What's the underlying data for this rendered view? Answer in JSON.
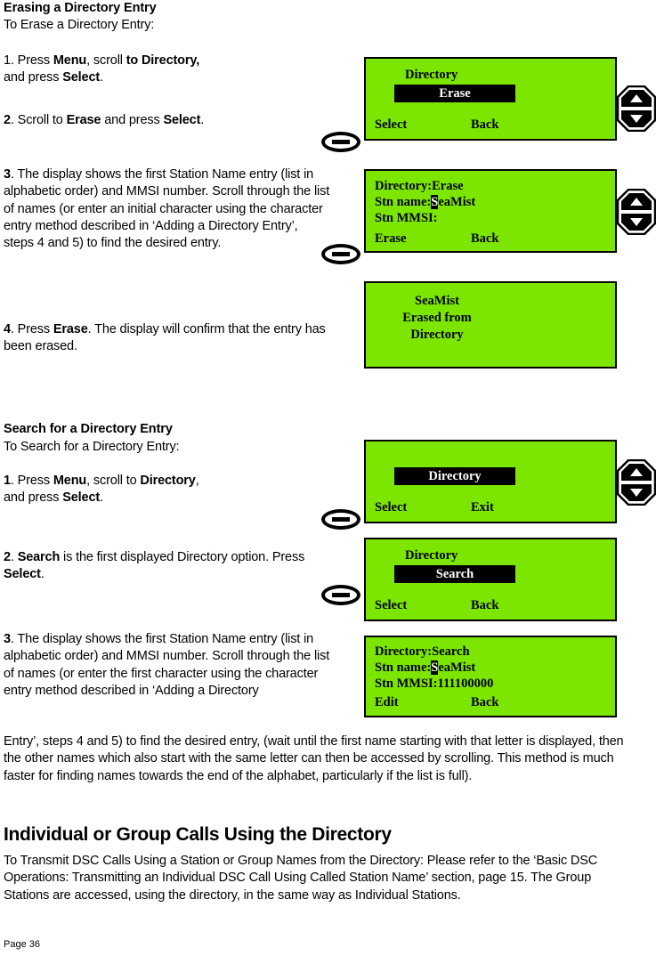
{
  "document": {
    "page_label": "Page 36"
  },
  "sections": {
    "erase": {
      "heading": "Erasing a Directory Entry",
      "subheading": "To Erase a Directory Entry:",
      "step1_line1_a": "1. Press ",
      "step1_line1_b": "Menu",
      "step1_line1_c": ", scroll ",
      "step1_line1_d": "to Directory,",
      "step1_line2_a": "and press ",
      "step1_line2_b": "Select",
      "step1_line2_c": ".",
      "step2_a": "2",
      "step2_b": ". Scroll to ",
      "step2_c": "Erase",
      "step2_d": " and press ",
      "step2_e": "Select",
      "step2_f": ".",
      "step3_a": "3",
      "step3_b": ". The display shows the first Station Name entry (list in alphabetic order) and MMSI number. Scroll through the list of names (or enter an initial character using the character entry method described in ‘Adding a Directory Entry’, steps 4 and 5) to find the desired entry.",
      "step4_a": "4",
      "step4_b": ". Press ",
      "step4_c": "Erase",
      "step4_d": ". The display will confirm that the entry has been erased."
    },
    "search": {
      "heading": "Search for a Directory Entry",
      "subheading": "To Search for a Directory Entry:",
      "step1_a": "1",
      "step1_b": ". Press ",
      "step1_c": "Menu",
      "step1_d": ", scroll to ",
      "step1_e": "Directory",
      "step1_f": ",",
      "step1_line2_a": "and press ",
      "step1_line2_b": "Select",
      "step1_line2_c": ".",
      "step2_a": "2",
      "step2_b": ". ",
      "step2_c": "Search",
      "step2_d": " is the first displayed Directory option. Press ",
      "step2_e": "Select",
      "step2_f": ".",
      "step3_col_a": "3",
      "step3_col_b": ". The display shows the first Station Name entry (list in alphabetic order) and MMSI number. Scroll through the list of names (or enter the first character using the character entry method described in ‘Adding a Directory",
      "step3_full": "Entry’, steps 4 and 5) to find the desired entry, (wait until the first name starting with that letter is displayed, then the other names which also start with the same letter can then be accessed by scrolling. This method is much faster for finding names towards the end of the alphabet, particularly if the list is full)."
    },
    "calls": {
      "heading": "Individual or Group Calls Using the Directory",
      "body": "To Transmit DSC Calls Using a Station or Group Names from the Directory: Please refer to the ‘Basic DSC Operations: Transmitting an Individual DSC Call Using Called Station Name’ section, page 15. The Group Stations are accessed, using the directory, in the same way as Individual Stations."
    }
  },
  "lcd_screens": [
    {
      "id": "erase-menu",
      "title": "Directory",
      "selected": "Erase",
      "softkey_left": "Select",
      "softkey_right": "Back"
    },
    {
      "id": "erase-entry",
      "line1": "Directory:Erase",
      "line2_label": "Stn name:",
      "line2_cursor": "S",
      "line2_rest": "eaMist",
      "line3": "Stn MMSI:",
      "softkey_left": "Erase",
      "softkey_right": "Back"
    },
    {
      "id": "erase-confirm",
      "line1": "SeaMist",
      "line2": "Erased from",
      "line3": "Directory"
    },
    {
      "id": "search-menu-directory",
      "selected": "Directory",
      "softkey_left": "Select",
      "softkey_right": "Exit"
    },
    {
      "id": "search-menu-search",
      "title": "Directory",
      "selected": "Search",
      "softkey_left": "Select",
      "softkey_right": "Back"
    },
    {
      "id": "search-entry",
      "line1": "Directory:Search",
      "line2_label": "Stn name:",
      "line2_cursor": "S",
      "line2_rest": "eaMist",
      "line3": "Stn MMSI:111100000",
      "softkey_left": "Edit",
      "softkey_right": "Back"
    }
  ],
  "colors": {
    "lcd_background": "#7ce600",
    "lcd_text": "#000000",
    "lcd_inverted_text": "#ffffff"
  }
}
